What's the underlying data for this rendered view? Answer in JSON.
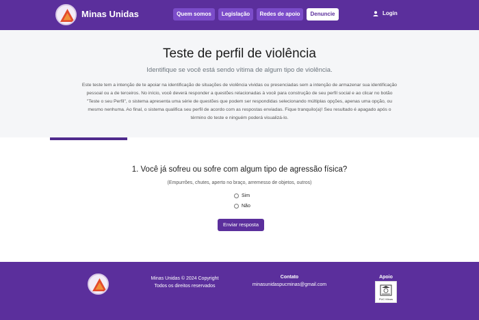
{
  "nav": {
    "brand": "Minas Unidas",
    "items": [
      "Quem somos",
      "Legislação",
      "Redes de apoio",
      "Denuncie"
    ],
    "login": "Login",
    "icons": {
      "login": "user-icon",
      "logo": "triangle-logo-icon"
    }
  },
  "hero": {
    "title": "Teste de perfil de violência",
    "subtitle": "Identifique se você está sendo vítima de algum tipo de violência.",
    "description_lines": [
      "Este teste tem a intenção de te apoiar na identificação de situações de violência vividas ou presenciadas sem a intenção de armazenar sua identificação",
      "pessoal ou a de terceiros. No início, você deverá responder a questões relacionadas à você para construção de seu perfil social e ao clicar no botão",
      "\"Teste o seu Perfil\", o sistema apresenta uma série de questões que podem ser respondidas selecionando múltiplas opções, apenas uma opção, ou",
      "mesmo nenhuma. Ao final, o sistema qualifica seu perfil de acordo com as respostas enviadas. Fique tranquilo(a)! Seu resultado é apagado após o",
      "término do teste e ninguém poderá visualizá-lo."
    ]
  },
  "question": {
    "text": "1. Você já sofreu ou sofre com algum tipo de agressão física?",
    "examples": "(Empurrões, chutes, aperto no braço, arremesso de objetos, outros)",
    "options": [
      "Sim",
      "Não"
    ],
    "submit": "Enviar resposta"
  },
  "footer": {
    "copyright_lines": [
      "Minas Unidas © 2024 Copyright",
      "Todos os direitos reservados"
    ],
    "contact_heading": "Contato",
    "contact_email": "minasunidaspucminas@gmail.com",
    "support_heading": "Apoio",
    "support_logo_text": "PUC Minas"
  },
  "colors": {
    "primary": "#5b2f9c",
    "button": "#7b4cc9",
    "hero_bg": "#f5f6f8"
  }
}
